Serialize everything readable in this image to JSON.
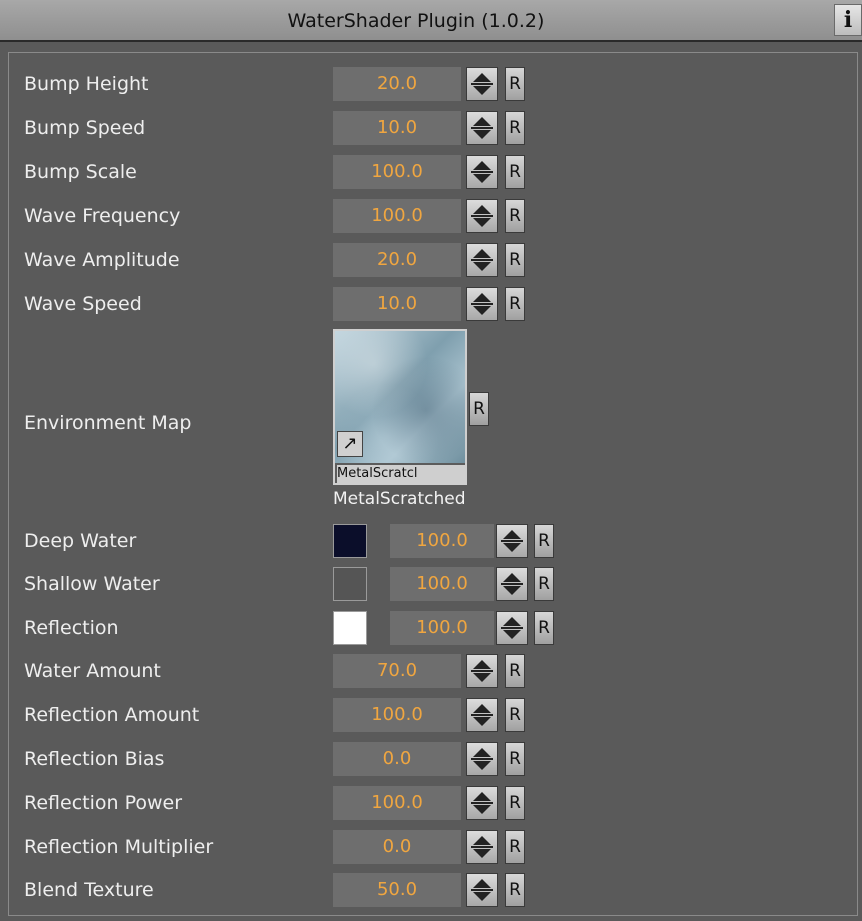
{
  "header": {
    "title": "WaterShader Plugin (1.0.2)",
    "info_label": "i"
  },
  "fields": [
    {
      "label": "Bump Height",
      "value": "20.0"
    },
    {
      "label": "Bump Speed",
      "value": "10.0"
    },
    {
      "label": "Bump Scale",
      "value": "100.0"
    },
    {
      "label": "Wave Frequency",
      "value": "100.0"
    },
    {
      "label": "Wave Amplitude",
      "value": "20.0"
    },
    {
      "label": "Wave Speed",
      "value": "10.0"
    }
  ],
  "environment_map": {
    "label": "Environment Map",
    "thumbnail_caption": "MetalScratcl",
    "texture_name": "MetalScratched"
  },
  "color_fields": [
    {
      "label": "Deep Water",
      "color": "#0b0e2a",
      "value": "100.0"
    },
    {
      "label": "Shallow Water",
      "color": "#555555",
      "value": "100.0"
    },
    {
      "label": "Reflection",
      "color": "#ffffff",
      "value": "100.0"
    }
  ],
  "fields2": [
    {
      "label": "Water Amount",
      "value": "70.0"
    },
    {
      "label": "Reflection Amount",
      "value": "100.0"
    },
    {
      "label": "Reflection Bias",
      "value": "0.0"
    },
    {
      "label": "Reflection Power",
      "value": "100.0"
    },
    {
      "label": "Reflection Multiplier",
      "value": "0.0"
    },
    {
      "label": "Blend Texture",
      "value": "50.0"
    }
  ],
  "reset_label": "R",
  "colors": {
    "value_text": "#f0a640",
    "label_text": "#eeeeee",
    "panel_bg": "#5a5a5a"
  }
}
